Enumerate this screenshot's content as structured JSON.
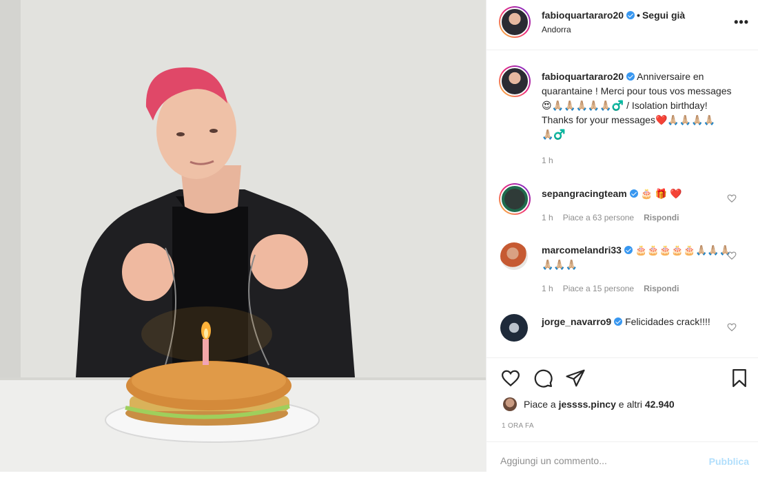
{
  "header": {
    "username": "fabioquartararo20",
    "follow_label": "Segui già",
    "location": "Andorra",
    "more_icon": "more-options-icon",
    "more_glyph": "•••"
  },
  "caption": {
    "username": "fabioquartararo20",
    "text": "Anniversaire en quarantaine ! Merci pour tous vos messages 😍🙏🏼🙏🏼🙏🏼🙏🏼🙏🏼‍♂️ / Isolation birthday! Thanks for your messages❤️🙏🏼🙏🏼🙏🏼🙏🏼🙏🏼‍♂️",
    "time": "1 h"
  },
  "comments": [
    {
      "username": "sepangracingteam",
      "text": "🎂 🎁 ❤️",
      "time": "1 h",
      "likes": "Piace a 63 persone",
      "reply": "Rispondi"
    },
    {
      "username": "marcomelandri33",
      "text": "🎂🎂🎂🎂🎂🙏🏼🙏🏼🙏🏼🙏🏼🙏🏼🙏🏼",
      "time": "1 h",
      "likes": "Piace a 15 persone",
      "reply": "Rispondi"
    },
    {
      "username": "jorge_navarro9",
      "text": "Felicidades crack!!!!"
    }
  ],
  "actions": {
    "likes_prefix": "Piace a",
    "liked_by": "jessss.pincy",
    "likes_mid": "e altri",
    "likes_count": "42.940",
    "timestamp": "1 ORA FA"
  },
  "add_comment": {
    "placeholder": "Aggiungi un commento...",
    "publish_label": "Pubblica"
  },
  "colors": {
    "verified": "#3897f0",
    "publish_disabled": "#b2dffc",
    "meta_text": "#8e8e8e"
  }
}
